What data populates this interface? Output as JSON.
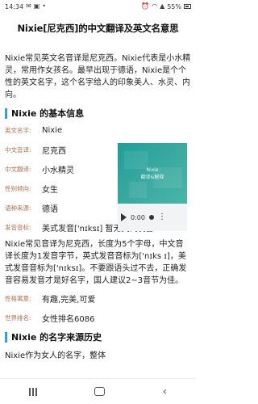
{
  "status_bar": {
    "time": "14:34",
    "battery": "55%"
  },
  "page": {
    "title": "Nixie[尼克西]的中文翻译及英文名意思",
    "intro": "Nixie常见英文名音译是尼克西。Nixie代表是小水精灵，常用作女孩名。最早出现于德语，Nixie是个个性的英文名字，这个名字给人的印象美人、水灵、内向。"
  },
  "basic_info": {
    "heading": "Nixie 的基本信息",
    "rows": [
      {
        "label": "英文名字:",
        "value": "Nixie"
      },
      {
        "label": "中文音译:",
        "value": "尼克西"
      },
      {
        "label": "中文翻译:",
        "value": "小水精灵"
      },
      {
        "label": "性别倾向:",
        "value": "女生"
      },
      {
        "label": "语种来源:",
        "value": "德语"
      },
      {
        "label": "发音音标:",
        "value": "美式发音['nɪksɪ]   暂无英式发音"
      }
    ]
  },
  "media": {
    "line1": "Nixie",
    "line2": "翻译&解释",
    "time": "0:00"
  },
  "pronunciation_para": "Nixie常见音译为尼克西，长度为5个字母，中文音译长度为1发音字节，英式发音音标为['nɪks ɪ]，美式发音音标为['nɪksɪ]。不要跟语头过不去，正确发音容易发音才是好名字，国人建议2~3音节为佳。",
  "traits": [
    {
      "label": "性格寓意:",
      "value": "有趣,完美,可爱"
    },
    {
      "label": "世界排名:",
      "value": "女性排名6086"
    }
  ],
  "origin": {
    "heading": "Nixie 的名字来源历史",
    "partial_text": "Nixie作为女人的名字，整体"
  }
}
